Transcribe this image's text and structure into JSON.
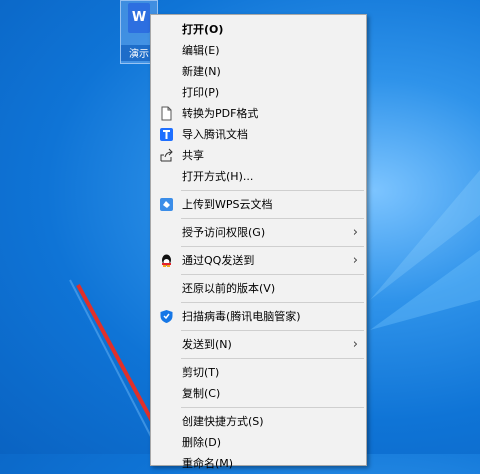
{
  "desktop": {
    "file_icon_glyph": "W",
    "file_label": "演示"
  },
  "menu": {
    "items": [
      {
        "label": "打开(O)",
        "bold": true
      },
      {
        "label": "编辑(E)"
      },
      {
        "label": "新建(N)"
      },
      {
        "label": "打印(P)"
      },
      {
        "label": "转换为PDF格式",
        "icon": "document-icon"
      },
      {
        "label": "导入腾讯文档",
        "icon": "tencent-docs-icon"
      },
      {
        "label": "共享",
        "icon": "share-icon"
      },
      {
        "label": "打开方式(H)..."
      },
      {
        "label": "上传到WPS云文档",
        "icon": "wps-cloud-icon"
      },
      {
        "label": "授予访问权限(G)",
        "submenu": true
      },
      {
        "label": "通过QQ发送到",
        "icon": "qq-penguin-icon",
        "submenu": true
      },
      {
        "label": "还原以前的版本(V)"
      },
      {
        "label": "扫描病毒(腾讯电脑管家)",
        "icon": "shield-icon"
      },
      {
        "label": "发送到(N)",
        "submenu": true
      },
      {
        "label": "剪切(T)"
      },
      {
        "label": "复制(C)"
      },
      {
        "label": "创建快捷方式(S)"
      },
      {
        "label": "删除(D)"
      },
      {
        "label": "重命名(M)"
      }
    ],
    "submenu_arrow": "›"
  },
  "colors": {
    "annotation_arrow": "#e0302a",
    "desktop_blue": "#0f74d6",
    "menu_bg": "#f2f2f2"
  }
}
